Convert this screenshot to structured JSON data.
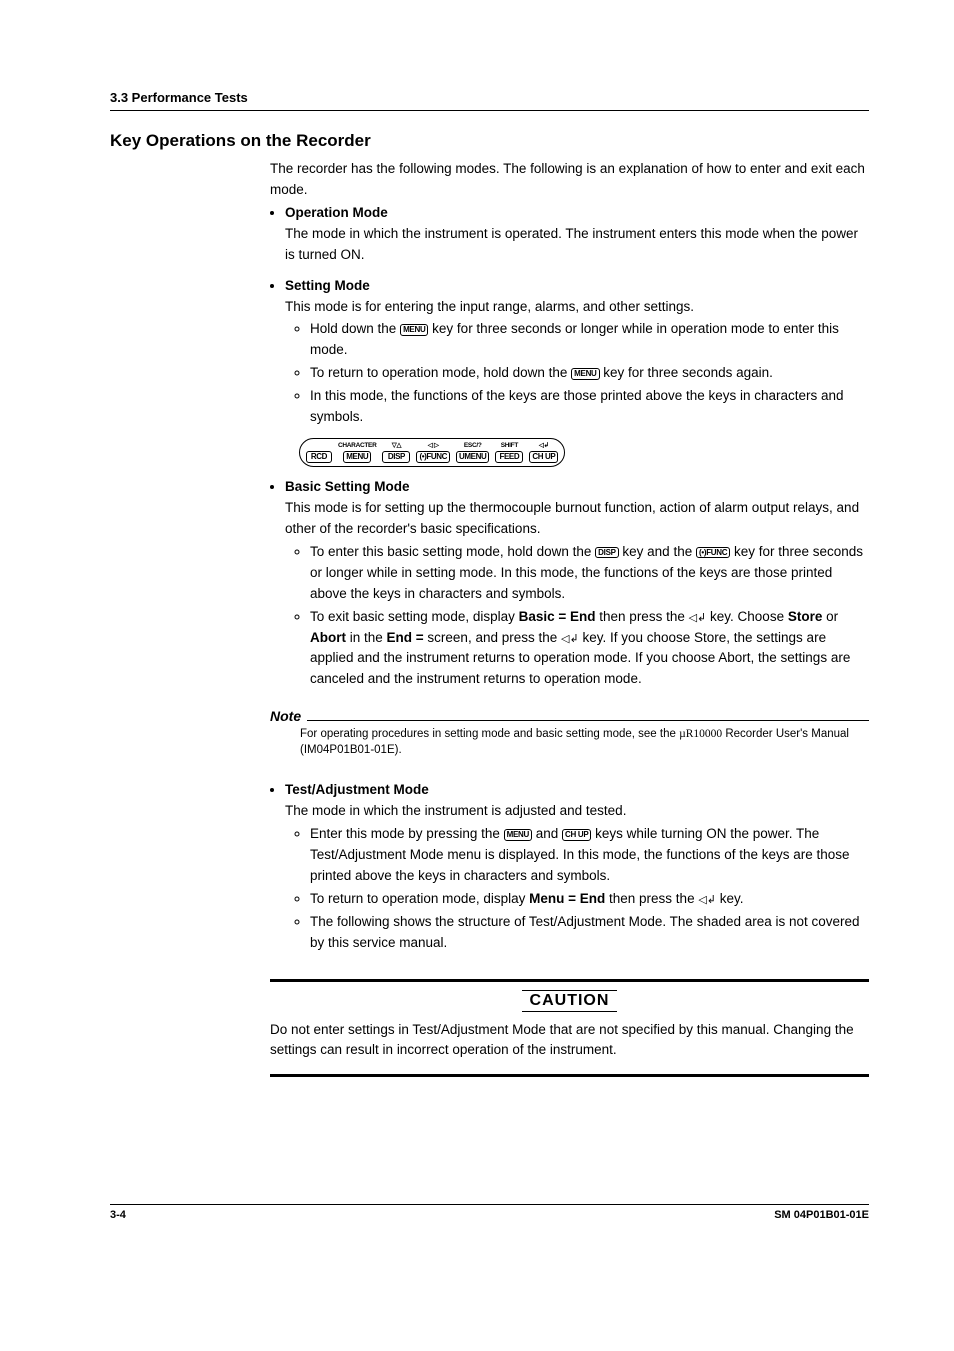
{
  "header_section": "3.3  Performance Tests",
  "title": "Key Operations on the Recorder",
  "intro": "The recorder has the following modes.  The following is an explanation of how to enter and exit each mode.",
  "modes": {
    "op": {
      "title": "Operation Mode",
      "desc": "The mode in which the instrument is operated.  The instrument enters this mode when the power is turned ON."
    },
    "set": {
      "title": "Setting Mode",
      "desc": "This mode is for entering the input range, alarms, and other settings.",
      "b1a": "Hold down the ",
      "b1b": " key for three seconds or longer while in operation mode to enter this mode.",
      "b2a": "To return to operation mode, hold down the ",
      "b2b": " key for three seconds again.",
      "b3": "In this mode, the functions of the keys are those printed above the keys in characters and symbols."
    },
    "basic": {
      "title": "Basic Setting Mode",
      "desc": "This mode is for setting up the thermocouple burnout function, action of alarm output relays, and other of the recorder's basic specifications.",
      "b1a": "To enter this basic setting mode, hold down the ",
      "b1b": " key and the ",
      "b1c": " key for three seconds or longer while in setting mode.  In this mode, the functions of the keys are those printed above the keys in characters and symbols.",
      "b2a": "To exit basic setting mode, display ",
      "b2b": "Basic = End",
      "b2c": " then press the ",
      "b2d": " key.  Choose ",
      "b2e": "Store",
      "b2f": " or ",
      "b2g": "Abort",
      "b2h": " in the ",
      "b2i": "End =",
      "b2j": " screen, and press the ",
      "b2k": " key.  If you choose Store, the settings are applied and the instrument returns to operation mode.  If you choose Abort, the settings are canceled and the instrument returns to operation mode."
    },
    "test": {
      "title": "Test/Adjustment Mode",
      "desc": "The mode in which the instrument is adjusted and tested.",
      "b1a": "Enter this mode by pressing the ",
      "b1b": " and ",
      "b1c": " keys while turning ON the power.  The Test/Adjustment Mode menu is displayed.  In this mode, the functions of the keys are those printed above the keys in characters and symbols.",
      "b2a": "To return to operation mode, display ",
      "b2b": "Menu = End",
      "b2c": " then press the ",
      "b2d": " key.",
      "b3": "The following shows the structure of Test/Adjustment Mode.  The shaded area is not covered by this service manual."
    }
  },
  "keys": {
    "menu": "MENU",
    "disp": "DISP",
    "func": "FUNC",
    "rofunc": "(•)FUNC",
    "chup": "CH UP",
    "rcd": "RCD",
    "feed": "FEED",
    "umenu": "UMENU"
  },
  "key_diagram": {
    "labels": [
      "",
      "CHARACTER",
      "▽△",
      "◁ ▷",
      "ESC/?",
      "SHIFT",
      "◁↲"
    ],
    "keys": [
      "RCD",
      "MENU",
      "DISP",
      "(•)FUNC",
      "UMENU",
      "FEED",
      "CH UP"
    ]
  },
  "enter_icon": "◁↲",
  "note": {
    "label": "Note",
    "text_a": "For operating procedures in setting mode and basic setting mode, see the ",
    "text_b": "µR10000",
    "text_c": " Recorder User's Manual (IM04P01B01-01E)."
  },
  "caution": {
    "label": "CAUTION",
    "text": "Do not enter settings in Test/Adjustment Mode that are not specified by this manual.  Changing the settings can result in incorrect operation of the instrument."
  },
  "footer": {
    "page": "3-4",
    "doc": "SM 04P01B01-01E"
  }
}
